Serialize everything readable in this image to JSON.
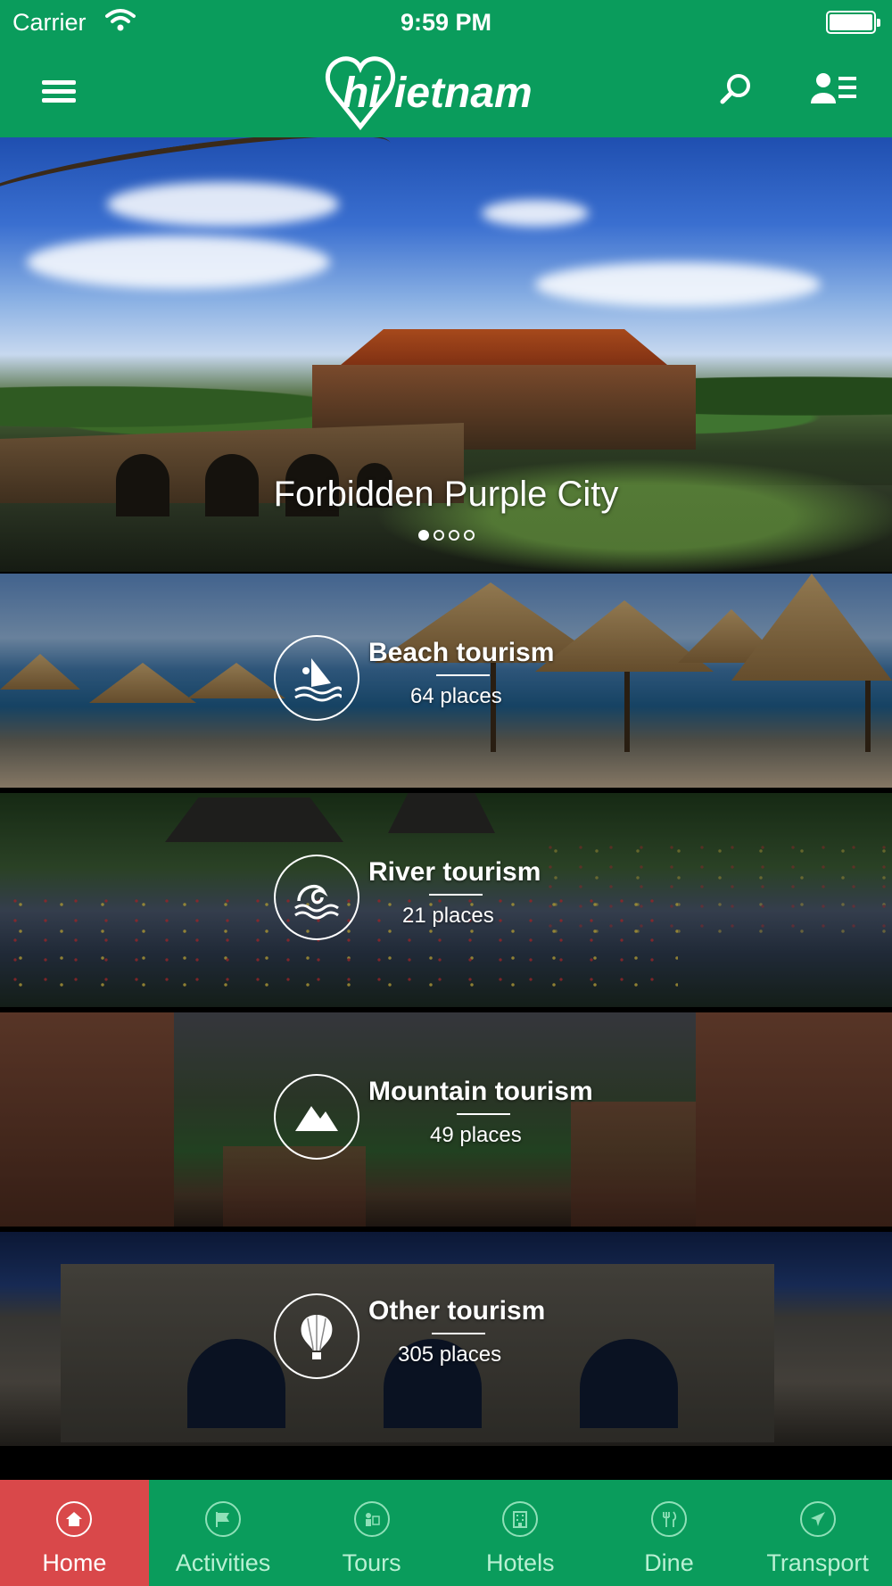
{
  "status_bar": {
    "carrier": "Carrier",
    "time": "9:59 PM"
  },
  "nav": {
    "logo_text": "hiVietnam",
    "menu_icon": "hamburger-icon",
    "search_icon": "search-icon",
    "profile_icon": "profile-list-icon"
  },
  "hero": {
    "title": "Forbidden Purple City",
    "slide_count": 4,
    "active_slide": 1
  },
  "categories": [
    {
      "title": "Beach tourism",
      "count": "64 places",
      "icon": "windsurf-icon"
    },
    {
      "title": "River tourism",
      "count": "21 places",
      "icon": "wave-icon"
    },
    {
      "title": "Mountain tourism",
      "count": "49 places",
      "icon": "mountain-icon"
    },
    {
      "title": "Other tourism",
      "count": "305 places",
      "icon": "hot-air-balloon-icon"
    }
  ],
  "tabs": [
    {
      "label": "Home",
      "icon": "home-icon",
      "active": true
    },
    {
      "label": "Activities",
      "icon": "flag-icon",
      "active": false
    },
    {
      "label": "Tours",
      "icon": "tour-icon",
      "active": false
    },
    {
      "label": "Hotels",
      "icon": "hotel-icon",
      "active": false
    },
    {
      "label": "Dine",
      "icon": "cutlery-icon",
      "active": false
    },
    {
      "label": "Transport",
      "icon": "plane-icon",
      "active": false
    }
  ],
  "colors": {
    "primary_green": "#0a9c5c",
    "active_tab_red": "#d9484a"
  }
}
